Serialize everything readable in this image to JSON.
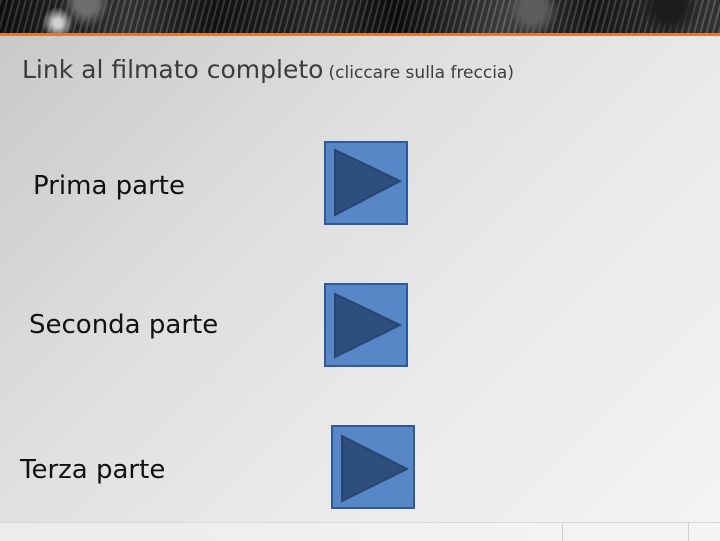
{
  "title": {
    "main": "Link al filmato completo",
    "note": "(cliccare sulla freccia)"
  },
  "parts": [
    {
      "label": "Prima parte",
      "button_icon": "play-arrow-icon"
    },
    {
      "label": "Seconda parte",
      "button_icon": "play-arrow-icon"
    },
    {
      "label": "Terza parte",
      "button_icon": "play-arrow-icon"
    }
  ],
  "colors": {
    "accent": "#e27a2a",
    "button_fill": "#5887c8",
    "button_border": "#2f5a9a",
    "arrow_fill": "#2e4f7e"
  }
}
